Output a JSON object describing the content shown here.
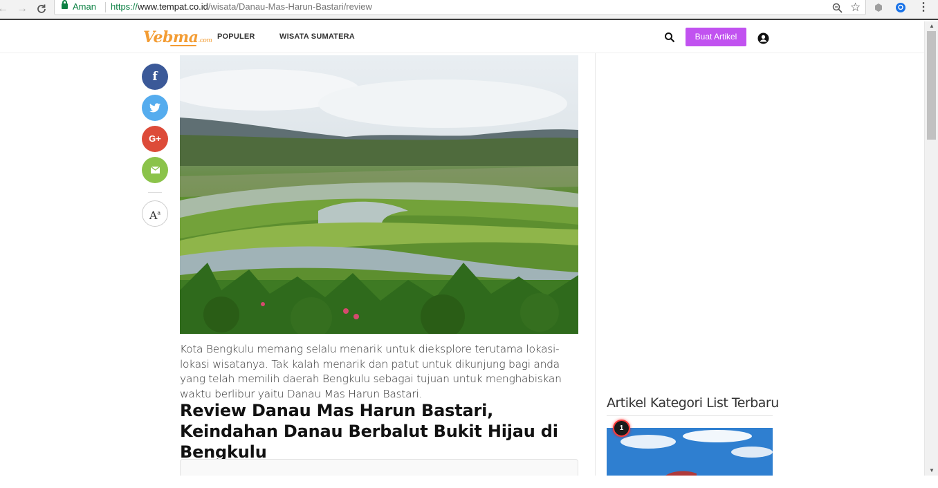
{
  "browser": {
    "secure_label": "Aman",
    "url_https": "https://",
    "url_host": "www.tempat.co.id",
    "url_path": "/wisata/Danau-Mas-Harun-Bastari/review"
  },
  "header": {
    "logo_text": "Vebma",
    "logo_suffix": ".com",
    "menu": [
      "POPULER",
      "WISATA SUMATERA"
    ],
    "create_button": "Buat Artikel"
  },
  "share": {
    "facebook": "f",
    "google_plus": "G+",
    "font_size_label": "A",
    "font_size_sup": "a"
  },
  "article": {
    "intro": "Kota Bengkulu memang selalu menarik untuk dieksplore terutama lokasi-lokasi wisatanya. Tak kalah menarik dan patut untuk dikunjung bagi anda yang telah memilih daerah Bengkulu sebagai tujuan untuk menghabiskan waktu berlibur yaitu Danau Mas Harun Bastari.",
    "title": "Review Danau Mas Harun Bastari, Keindahan Danau Berbalut Bukit Hijau di Bengkulu"
  },
  "sidebar": {
    "section_title": "Artikel Kategori List Terbaru",
    "first_rank": "1"
  },
  "colors": {
    "brand_orange": "#f39c33",
    "button_purple": "#c152f0",
    "facebook": "#3b5998",
    "twitter": "#55acee",
    "google_plus": "#dd4b39",
    "email": "#8bc34a"
  }
}
